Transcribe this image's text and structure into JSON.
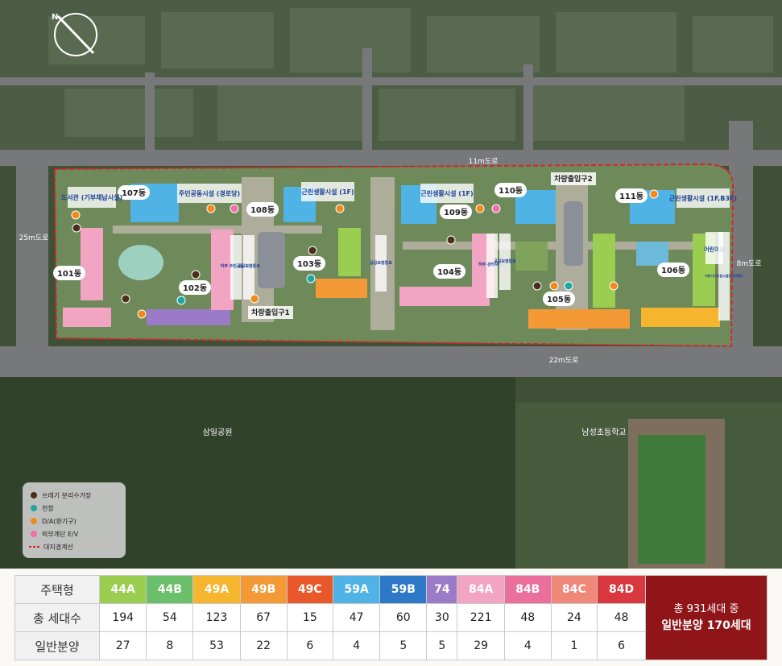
{
  "colors": {
    "44A": "#9acd50",
    "44B": "#6bbf6a",
    "49A": "#f5b52e",
    "49B": "#f39a36",
    "49C": "#e8582a",
    "59A": "#4fb3e6",
    "59B": "#2d79c7",
    "74": "#9b7bc8",
    "84A": "#f2a5c2",
    "84B": "#ea6f9a",
    "84C": "#f0887a",
    "84D": "#d9383e",
    "trash": "#4a2f1a",
    "chimney": "#1fa6a0",
    "da": "#f08a1c",
    "ev": "#ef6fa6",
    "boundary": "#d3262c"
  },
  "roads": {
    "north": "11m도로",
    "west": "25m도로",
    "east": "8m도로",
    "south": "22m도로"
  },
  "places": {
    "park": "삼일공원",
    "school": "남성초등학교"
  },
  "buildings": [
    "101동",
    "102동",
    "103동",
    "104동",
    "105동",
    "106동",
    "107동",
    "108동",
    "109동",
    "110동",
    "111동"
  ],
  "facilities": {
    "library": "도서관\n(기부채납시설)",
    "community_senior": "주민공동시설\n(경로당)",
    "retail1": "근린생활시설\n(1F)",
    "retail2": "근린생활시설\n(1F)",
    "retail3": "근린생활시설\n(1F,B3F)",
    "community_lower": "하부 주민공동시설",
    "walkway1": "공공보행통로",
    "walkway2": "공공보행통로",
    "walkway3": "공공보행통로",
    "management": "하부 관리사무소",
    "daycare": "어린이집",
    "community_center": "커뮤니티지원시설(분양예정)",
    "gate1": "차량출입구1",
    "gate2": "차량출입구2"
  },
  "legend": [
    {
      "label": "쓰레기 분리수거장",
      "kind": "trash"
    },
    {
      "label": "천창",
      "kind": "chimney"
    },
    {
      "label": "D/A(환기구)",
      "kind": "da"
    },
    {
      "label": "외부계단 E/V",
      "kind": "ev"
    },
    {
      "label": "대지경계선",
      "kind": "boundary"
    }
  ],
  "table": {
    "header_label": "주택형",
    "types": [
      "44A",
      "44B",
      "49A",
      "49B",
      "49C",
      "59A",
      "59B",
      "74",
      "84A",
      "84B",
      "84C",
      "84D"
    ],
    "rows": [
      {
        "label": "총 세대수",
        "values": [
          "194",
          "54",
          "123",
          "67",
          "15",
          "47",
          "60",
          "30",
          "221",
          "48",
          "24",
          "48"
        ]
      },
      {
        "label": "일반분양",
        "values": [
          "27",
          "8",
          "53",
          "22",
          "6",
          "4",
          "5",
          "5",
          "29",
          "4",
          "1",
          "6"
        ]
      }
    ],
    "summary_line1": "총 931세대 중",
    "summary_line2": "일반분양 170세대"
  }
}
